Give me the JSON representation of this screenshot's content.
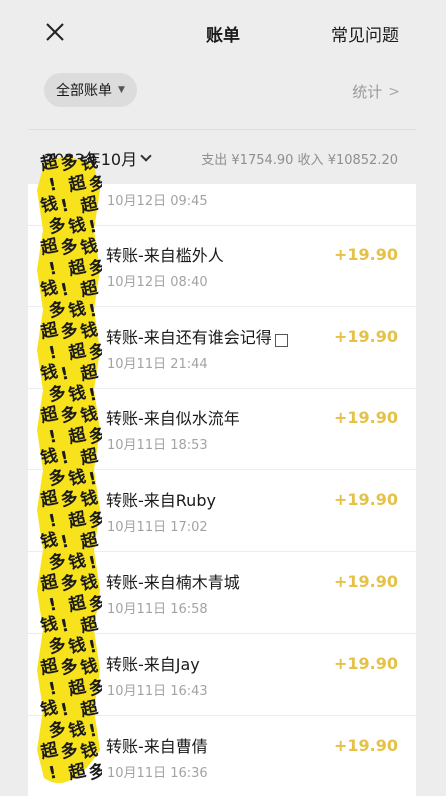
{
  "header": {
    "title": "账单",
    "faq_label": "常见问题"
  },
  "filter": {
    "chip_label": "全部账单",
    "stats_label": "统计"
  },
  "month": {
    "label": "2023年10月",
    "summary": "支出 ¥1754.90  收入 ¥10852.20"
  },
  "transactions": [
    {
      "title": "",
      "time": "10月12日 09:45",
      "amount": ""
    },
    {
      "title": "转账-来自槛外人",
      "time": "10月12日 08:40",
      "amount": "+19.90"
    },
    {
      "title": "转账-来自还有谁会记得",
      "time": "10月11日 21:44",
      "amount": "+19.90"
    },
    {
      "title": "转账-来自似水流年",
      "time": "10月11日 18:53",
      "amount": "+19.90"
    },
    {
      "title": "转账-来自Ruby",
      "time": "10月11日 17:02",
      "amount": "+19.90"
    },
    {
      "title": "转账-来自楠木青城",
      "time": "10月11日 16:58",
      "amount": "+19.90"
    },
    {
      "title": "转账-来自Jay",
      "time": "10月11日 16:43",
      "amount": "+19.90"
    },
    {
      "title": "转账-来自曹倩",
      "time": "10月11日 16:36",
      "amount": "+19.90"
    }
  ],
  "sticker": {
    "text": "超多钱!",
    "color": "#f7e21b"
  },
  "colors": {
    "income": "#e5c247",
    "background": "#ededed"
  }
}
